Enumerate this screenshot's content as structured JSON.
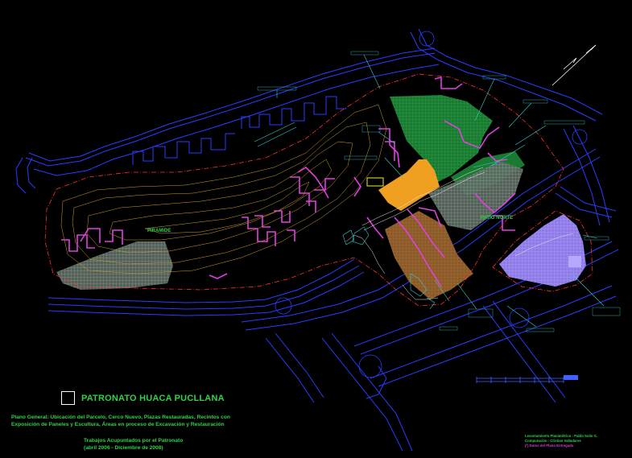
{
  "colors": {
    "background": "#000000",
    "street": "#2a3dff",
    "green_zone": "#1f8f3a",
    "grid_gray": "#9aa8a0",
    "brown_zone": "#8a5a2a",
    "orange_zone": "#f0a020",
    "purple_zone": "#8e7be8",
    "magenta": "#e040e0",
    "contour": "#d4a024",
    "boundary": "#ff3030",
    "leader": "#30d0d0",
    "text_green": "#2fd14a"
  },
  "map_labels": {
    "piramide": "PIRAMIDE",
    "patio_norte": "PATIO NORTE"
  },
  "title": "PATRONATO HUACA PUCLLANA",
  "description": [
    "Plano General: Ubicación del Parcelo, Cerco Nuevo, Plazas Restauradas, Recintos con",
    "Exposición de Paneles y Escultura, Áreas en proceso de Excavación y Restauración"
  ],
  "works": [
    "Trabajos Acupuntados por el Patronato",
    "(abril 2006 - Diciembre de 2008)"
  ],
  "credits": {
    "line1": "Levantamiento Planimétrico : Pablo Solis G.",
    "line2": "Computación : Cristian Valladares",
    "line3": "(*) Datos del Plano Entregado"
  }
}
